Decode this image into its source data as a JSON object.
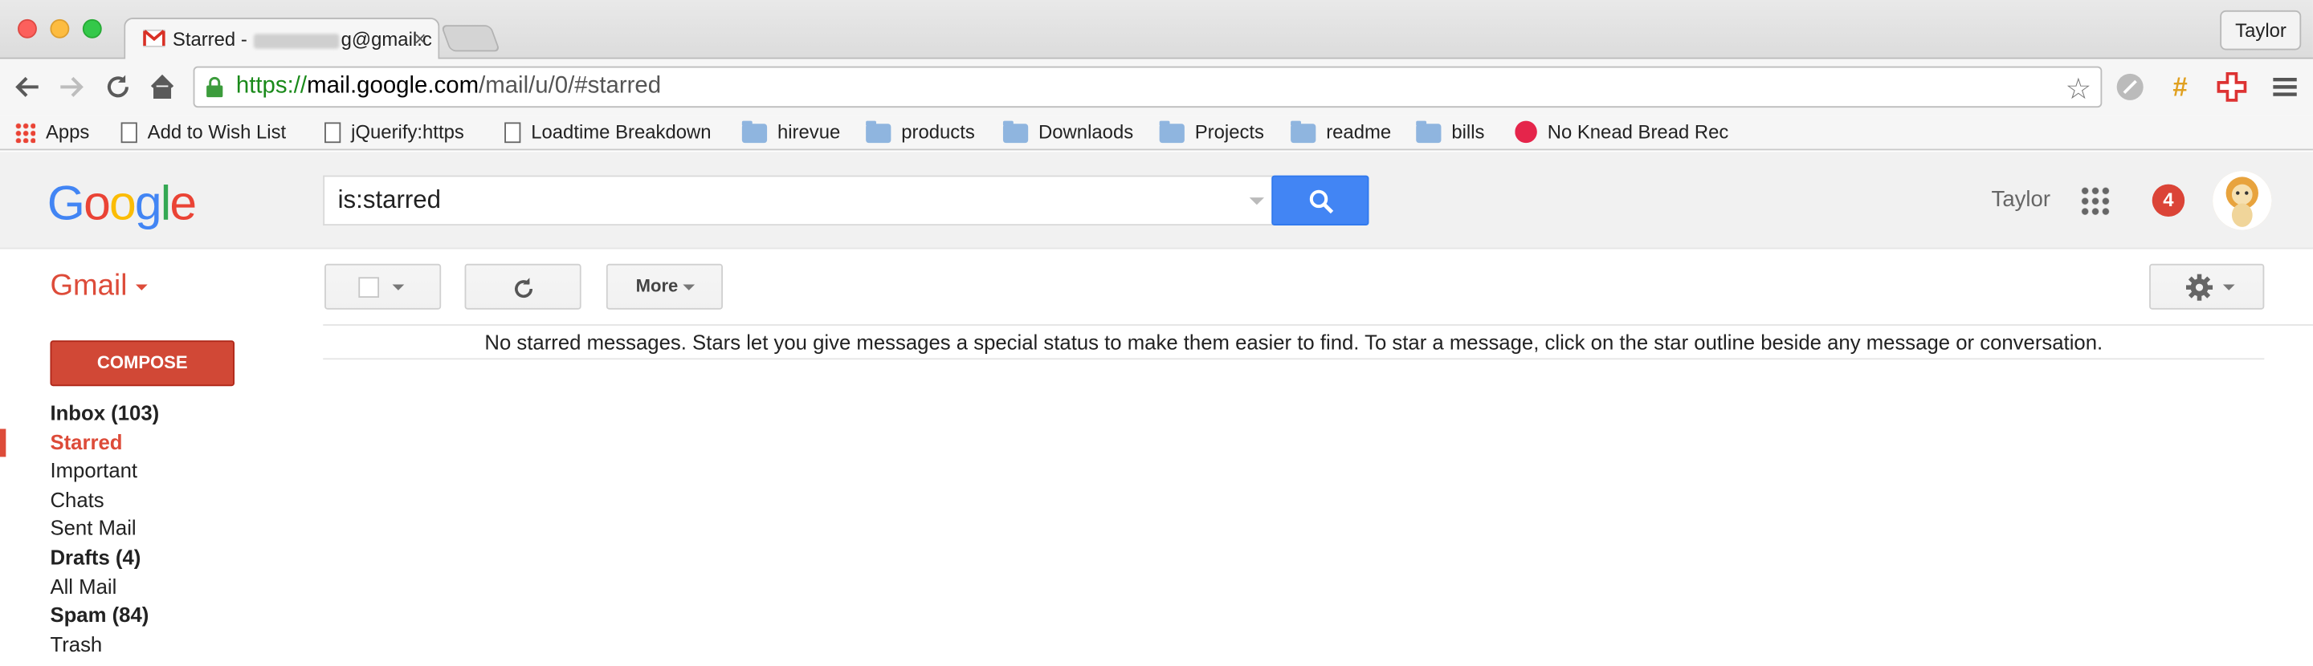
{
  "browser": {
    "tab_title_prefix": "Starred - ",
    "tab_title_suffix": "g@gmail.c",
    "profile": "Taylor",
    "url_scheme": "https://",
    "url_host": "mail.google.com",
    "url_path": "/mail/u/0/#starred"
  },
  "bookmarks": [
    {
      "label": "Apps",
      "icon": "apps-grid-icon"
    },
    {
      "label": "Add to Wish List",
      "icon": "page-icon"
    },
    {
      "label": "jQuerify:https",
      "icon": "page-icon"
    },
    {
      "label": "Loadtime Breakdown",
      "icon": "page-icon"
    },
    {
      "label": "hirevue",
      "icon": "folder-icon"
    },
    {
      "label": "products",
      "icon": "folder-icon"
    },
    {
      "label": "Downlaods",
      "icon": "folder-icon"
    },
    {
      "label": "Projects",
      "icon": "folder-icon"
    },
    {
      "label": "readme",
      "icon": "folder-icon"
    },
    {
      "label": "bills",
      "icon": "folder-icon"
    },
    {
      "label": "No Knead Bread Rec",
      "icon": "site-icon"
    }
  ],
  "gmail": {
    "logo": "Google",
    "search_value": "is:starred",
    "user_name": "Taylor",
    "notifications": "4",
    "app_label": "Gmail",
    "more_label": "More",
    "compose_label": "COMPOSE",
    "empty_message": "No starred messages. Stars let you give messages a special status to make them easier to find. To star a message, click on the star outline beside any message or conversation.",
    "nav": [
      {
        "label": "Inbox (103)"
      },
      {
        "label": "Starred"
      },
      {
        "label": "Important"
      },
      {
        "label": "Chats"
      },
      {
        "label": "Sent Mail"
      },
      {
        "label": "Drafts (4)"
      },
      {
        "label": "All Mail"
      },
      {
        "label": "Spam (84)"
      },
      {
        "label": "Trash"
      }
    ]
  },
  "colors": {
    "gmail_red": "#dd4b39",
    "search_blue": "#4285f4",
    "secure_green": "#1a8a1a"
  }
}
